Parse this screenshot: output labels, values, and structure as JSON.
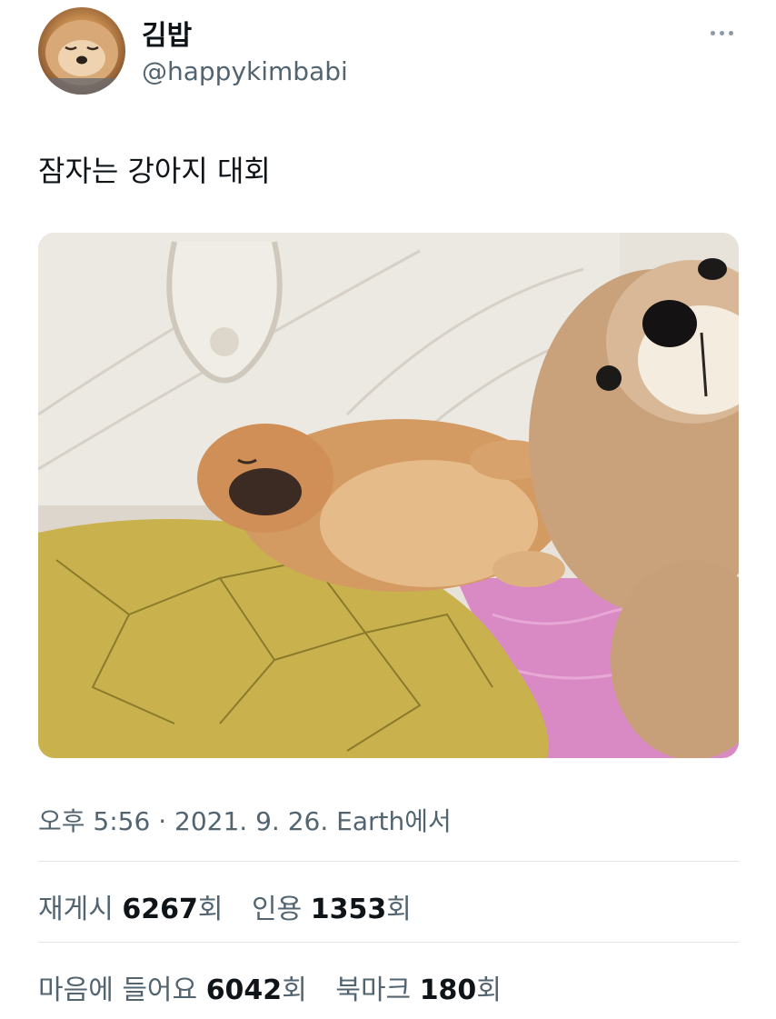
{
  "profile": {
    "display_name": "김밥",
    "handle": "@happykimbabi",
    "avatar_icon": "sleeping-puppy-avatar"
  },
  "more_icon": "more-horizontal-icon",
  "tweet": {
    "text": "잠자는 강아지 대회",
    "media_alt": "sleeping pomeranian puppy next to a teddy bear"
  },
  "meta": {
    "time": "오후 5:56",
    "separator": " · ",
    "date": "2021. 9. 26.",
    "source": "Earth에서"
  },
  "stats": {
    "retweets": {
      "label": "재게시 ",
      "value": "6267",
      "suffix": "회"
    },
    "quotes": {
      "label": "인용 ",
      "value": "1353",
      "suffix": "회"
    },
    "likes": {
      "label": "마음에 들어요 ",
      "value": "6042",
      "suffix": "회"
    },
    "bookmarks": {
      "label": "북마크 ",
      "value": "180",
      "suffix": "회"
    }
  },
  "colors": {
    "text_primary": "#0f1419",
    "text_secondary": "#536471",
    "divider": "#e1e6ea"
  }
}
